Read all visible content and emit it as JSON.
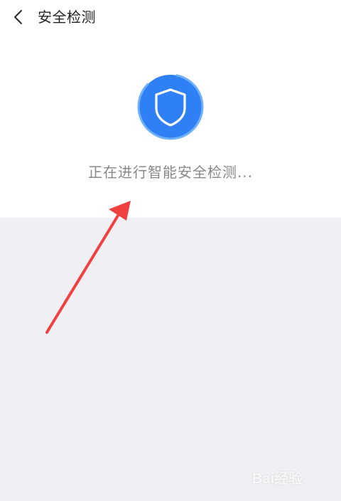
{
  "header": {
    "title": "安全检测",
    "back_icon": "chevron-left-icon"
  },
  "scan": {
    "icon": "shield-icon",
    "status_text": "正在进行智能安全检测...",
    "accent_color": "#2f80f5",
    "ring_color": "#4d9bfa"
  },
  "annotation": {
    "arrow_color": "#f04040"
  },
  "watermark": {
    "text": "Bai经验"
  }
}
